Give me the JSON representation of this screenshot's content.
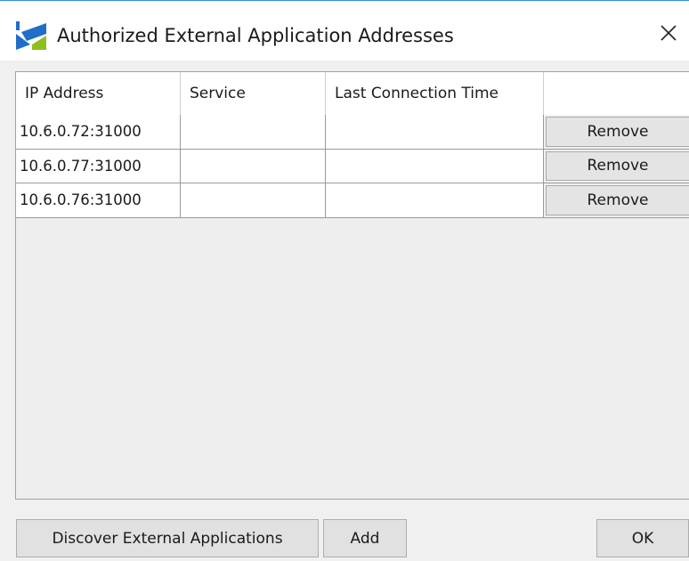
{
  "window": {
    "title": "Authorized External Application Addresses",
    "app_icon": "brand-logo-icon",
    "close_icon": "close-icon"
  },
  "table": {
    "columns": [
      "IP Address",
      "Service",
      "Last Connection Time",
      ""
    ],
    "rows": [
      {
        "ip": "10.6.0.72:31000",
        "service": "",
        "last_connection": "",
        "action_label": "Remove"
      },
      {
        "ip": "10.6.0.77:31000",
        "service": "",
        "last_connection": "",
        "action_label": "Remove"
      },
      {
        "ip": "10.6.0.76:31000",
        "service": "",
        "last_connection": "",
        "action_label": "Remove"
      }
    ]
  },
  "footer": {
    "discover_label": "Discover External Applications",
    "add_label": "Add",
    "ok_label": "OK"
  },
  "colors": {
    "brand_blue": "#1f6fc8",
    "brand_green": "#8fbf1f",
    "window_bg": "#f0f0f0",
    "title_accent_border": "#3c8fd9"
  }
}
